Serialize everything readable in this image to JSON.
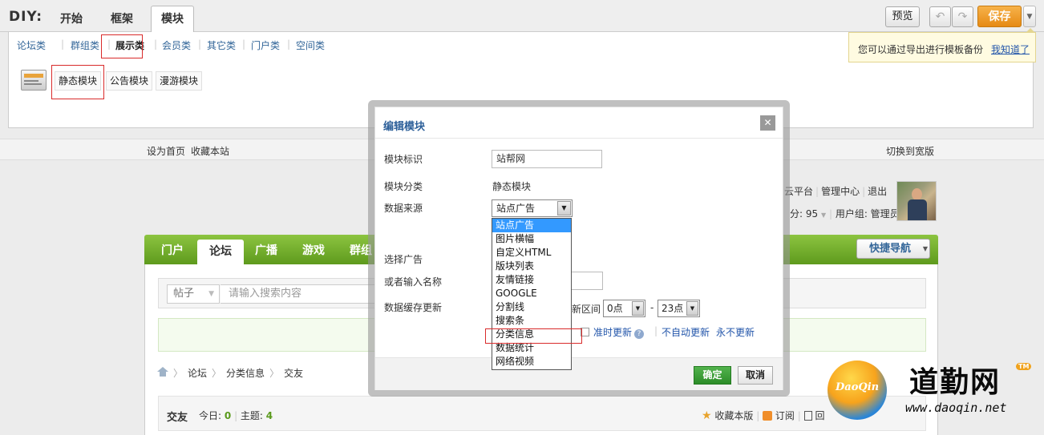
{
  "diy_bar": {
    "label": "DIY:",
    "tabs": [
      "开始",
      "框架",
      "模块"
    ],
    "preview": "预览",
    "undo": "↶",
    "redo": "↷",
    "save": "保存",
    "save_more": "▼"
  },
  "categories": [
    "论坛类",
    "群组类",
    "展示类",
    "会员类",
    "其它类",
    "门户类",
    "空间类"
  ],
  "modules": [
    "静态模块",
    "公告模块",
    "漫游模块"
  ],
  "hint": {
    "text": "您可以通过导出进行模板备份",
    "link": "我知道了"
  },
  "topnav": {
    "set_home": "设为首页",
    "favorite": "收藏本站",
    "switch_wide": "切换到宽版"
  },
  "user": {
    "links": [
      "云平台",
      "管理中心",
      "退出"
    ],
    "stats_prefix": "分: 95",
    "group": "用户组: 管理员"
  },
  "main_nav": {
    "items": [
      "门户",
      "论坛",
      "广播",
      "游戏",
      "群组"
    ],
    "quick_nav": "快捷导航",
    "quick_nav_caret": "▼"
  },
  "search": {
    "scope": "帖子",
    "scope_caret": "▼",
    "placeholder": "请输入搜索内容"
  },
  "breadcrumb": [
    "论坛",
    "分类信息",
    "交友"
  ],
  "forum": {
    "name": "交友",
    "today_label": "今日:",
    "today": "0",
    "topics_label": "主题:",
    "topics": "4",
    "favorite": "收藏本版",
    "subscribe": "订阅",
    "last": "回"
  },
  "modal": {
    "title": "编辑模块",
    "close": "✕",
    "fields": {
      "id_label": "模块标识",
      "id_value": "站帮网",
      "cat_label": "模块分类",
      "cat_value": "静态模块",
      "src_label": "数据来源",
      "src_value": "站点广告",
      "ad_label": "选择广告",
      "name_label": "或者输入名称",
      "cache_label": "数据缓存更新",
      "range_label": "新区间",
      "range_from": "0点",
      "range_to": "23点",
      "ontime": "准时更新",
      "no_auto": "不自动更新",
      "never": "永不更新"
    },
    "ok": "确定",
    "cancel": "取消"
  },
  "source_options": [
    "站点广告",
    "图片横幅",
    "自定义HTML",
    "版块列表",
    "友情链接",
    "GOOGLE",
    "分割线",
    "搜索条",
    "分类信息",
    "数据统计",
    "网络视频"
  ],
  "watermark": {
    "ball_text": "DaoQin",
    "cn": "道勤网",
    "tm": "TM",
    "url": "www.daoqin.net"
  }
}
